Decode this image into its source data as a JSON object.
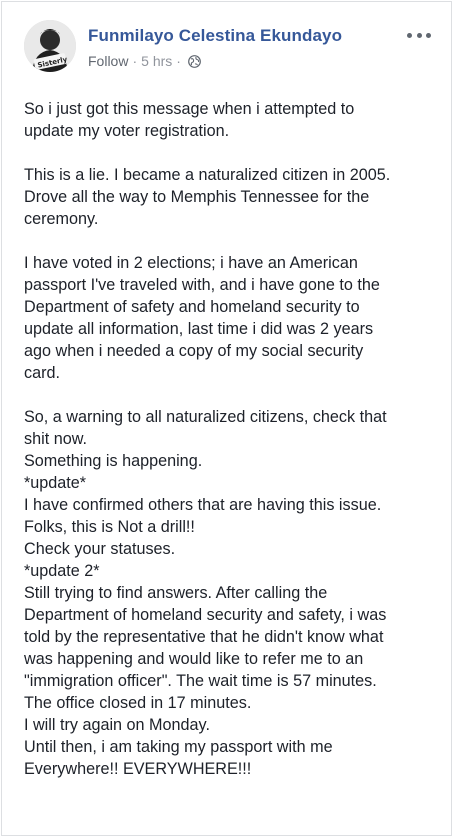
{
  "post": {
    "author": "Funmilayo Celestina Ekundayo",
    "follow_label": "Follow",
    "separator": "·",
    "timestamp": "5 hrs",
    "separator2": "·",
    "avatar_caption": "Sisterly",
    "icons": {
      "privacy": "globe-icon",
      "more": "more-options-icon"
    },
    "paragraphs": [
      {
        "lines": [
          "So i just got this message when i attempted to",
          "update my voter registration."
        ]
      },
      {
        "lines": [
          "This is a lie. I became a naturalized citizen in 2005.",
          "Drove all the way to Memphis Tennessee for the",
          "ceremony."
        ]
      },
      {
        "lines": [
          "I have voted in 2 elections; i have an American",
          "passport I've traveled with, and i have gone to the",
          "Department of safety and homeland security to",
          "update all information, last time i did was 2 years",
          "ago when i needed a copy of my social security",
          "card."
        ]
      },
      {
        "lines": [
          "So, a warning to all naturalized citizens, check that",
          "shit now.",
          "Something is happening.",
          "*update*",
          "I have confirmed others that are having this issue.",
          "Folks, this is Not a drill!!",
          "Check your statuses.",
          "*update 2*",
          "Still trying to find answers. After calling the",
          "Department of homeland security and safety, i was",
          "told by the representative that he didn't know what",
          "was happening and would like to refer me to an",
          "\"immigration officer\". The wait time is 57 minutes.",
          "The office closed in 17 minutes.",
          "I will try again on Monday.",
          "Until then, i am taking my passport with me",
          "Everywhere!! EVERYWHERE!!!"
        ]
      }
    ]
  },
  "colors": {
    "author_link": "#365899",
    "meta_text": "#90949c",
    "body_text": "#1d2129",
    "border": "#dddfe2"
  }
}
